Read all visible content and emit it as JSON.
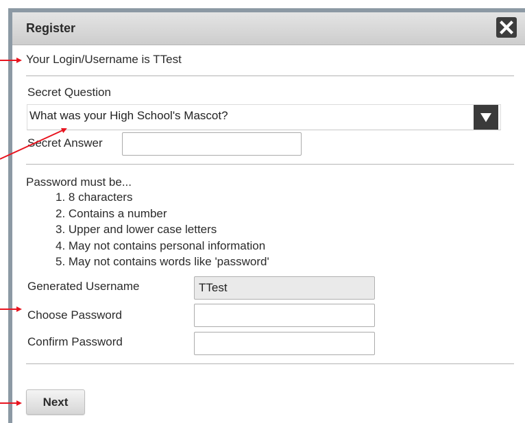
{
  "dialog": {
    "title": "Register",
    "close_icon": "close-x-icon",
    "login_message": "Your Login/Username is TTest"
  },
  "secret": {
    "question_label": "Secret Question",
    "question_selected": "What was your High School's Mascot?",
    "answer_label": "Secret Answer",
    "answer_value": ""
  },
  "password_rules": {
    "heading": "Password must be...",
    "items": [
      "1. 8 characters",
      "2. Contains a number",
      "3. Upper and lower case letters",
      "4. May not contains personal information",
      "5. May not contains words like 'password'"
    ]
  },
  "form": {
    "generated_username_label": "Generated Username",
    "generated_username_value": "TTest",
    "choose_password_label": "Choose Password",
    "choose_password_value": "",
    "confirm_password_label": "Confirm Password",
    "confirm_password_value": ""
  },
  "actions": {
    "next_label": "Next"
  },
  "colors": {
    "annotation_arrow": "#e8141f",
    "titlebar": "#d6d6d6",
    "select_arrow_bg": "#3a3a3a"
  }
}
